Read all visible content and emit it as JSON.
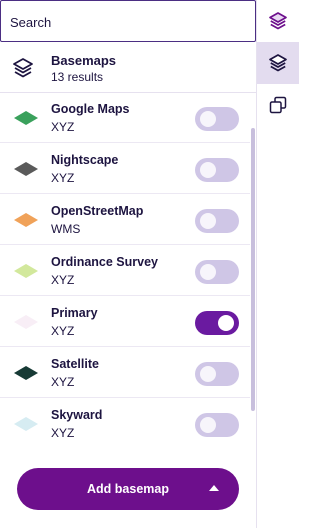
{
  "search": {
    "placeholder": "Search",
    "value": ""
  },
  "group": {
    "title": "Basemaps",
    "count": "13 results",
    "icon": "layers-icon"
  },
  "basemaps": [
    {
      "name": "Google Maps",
      "type": "XYZ",
      "color": "#3aa15c",
      "enabled": false
    },
    {
      "name": "Nightscape",
      "type": "XYZ",
      "color": "#5a5a5a",
      "enabled": false
    },
    {
      "name": "OpenStreetMap",
      "type": "WMS",
      "color": "#f0a259",
      "enabled": false
    },
    {
      "name": "Ordinance Survey",
      "type": "XYZ",
      "color": "#d2e89c",
      "enabled": false
    },
    {
      "name": "Primary",
      "type": "XYZ",
      "color": "#f8eef6",
      "enabled": true
    },
    {
      "name": "Satellite",
      "type": "XYZ",
      "color": "#173a35",
      "enabled": false
    },
    {
      "name": "Skyward",
      "type": "XYZ",
      "color": "#d6ecf2",
      "enabled": false
    }
  ],
  "footer": {
    "add_label": "Add basemap"
  },
  "rail": [
    {
      "icon": "layers-icon",
      "active": false
    },
    {
      "icon": "basemap-layers-icon",
      "active": true
    },
    {
      "icon": "copy-layers-icon",
      "active": false
    }
  ],
  "colors": {
    "accent": "#6d0f8c",
    "toggle_off": "#cfc6e6",
    "text": "#1d1440"
  }
}
